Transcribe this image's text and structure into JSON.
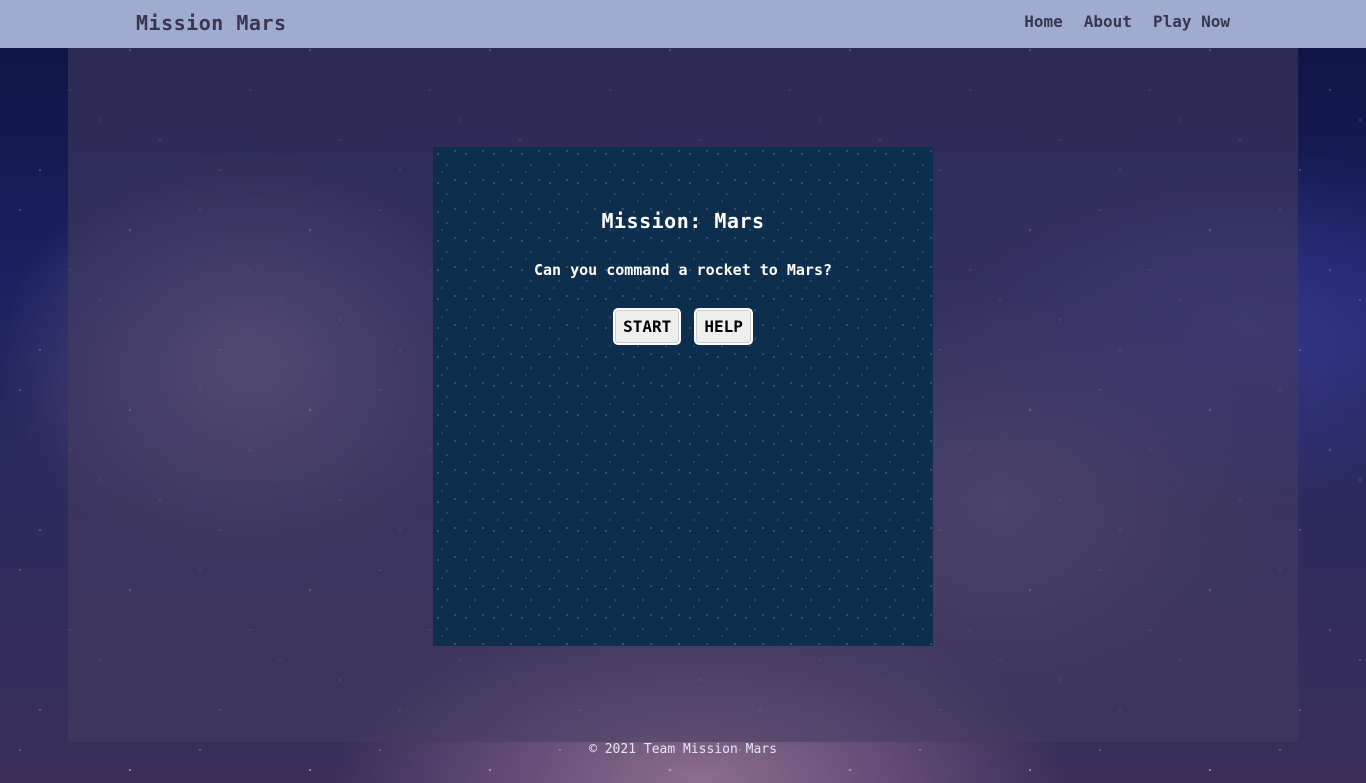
{
  "header": {
    "brand": "Mission Mars",
    "nav": [
      "Home",
      "About",
      "Play Now"
    ]
  },
  "game": {
    "title": "Mission: Mars",
    "subtitle": "Can you command a rocket to Mars?",
    "start_label": "START",
    "help_label": "HELP"
  },
  "footer": {
    "copyright": "© 2021 Team Mission Mars"
  },
  "colors": {
    "header_bg": "#9faccf",
    "game_box_bg": "#0d2e4d",
    "text_dark": "#3a3550"
  }
}
